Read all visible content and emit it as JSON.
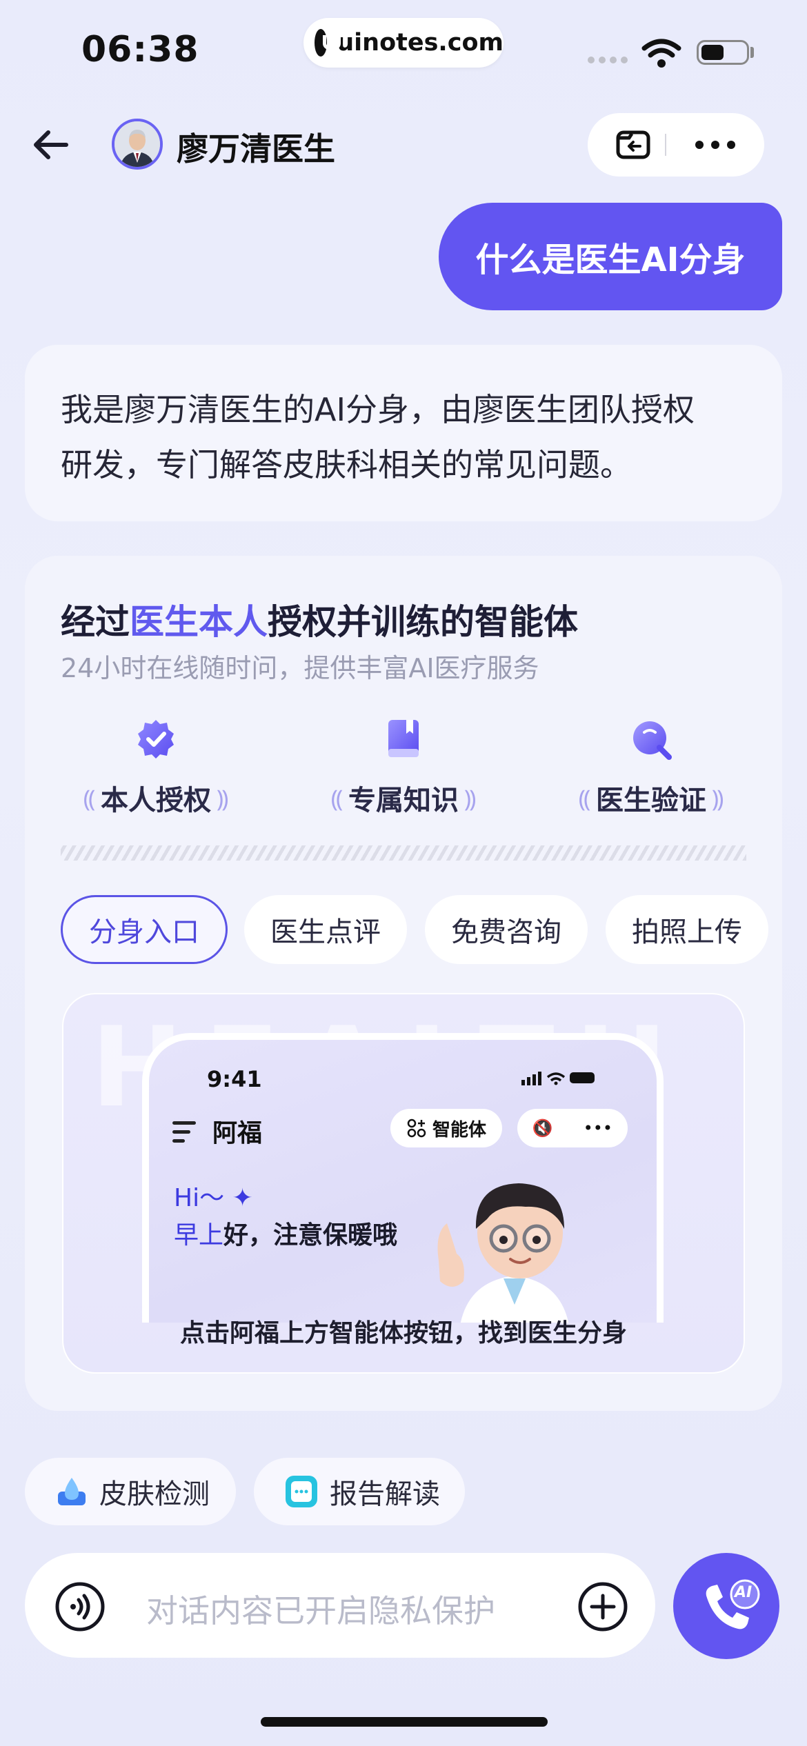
{
  "status_bar": {
    "time": "06:38",
    "url": "uinotes.com"
  },
  "header": {
    "doctor_name": "廖万清医生"
  },
  "chat": {
    "user_message": "什么是医生AI分身",
    "ai_message_line1": "我是廖万清医生的AI分身，由廖医生团队授权",
    "ai_message_line2": "研发，专门解答皮肤科相关的常见问题。"
  },
  "card": {
    "title_pre": "经过",
    "title_highlight": "医生本人",
    "title_post": "授权并训练的智能体",
    "subtitle": "24小时在线随时问，提供丰富AI医疗服务",
    "features": [
      {
        "label": "本人授权",
        "icon": "shield-check-icon"
      },
      {
        "label": "专属知识",
        "icon": "book-icon"
      },
      {
        "label": "医生验证",
        "icon": "magnifier-icon"
      }
    ],
    "tabs": [
      "分身入口",
      "医生点评",
      "免费咨询",
      "拍照上传"
    ],
    "active_tab": "分身入口",
    "promo": {
      "bg_text": "HEALTH",
      "phone_time": "9:41",
      "assistant_name": "阿福",
      "agent_button": "智能体",
      "hi": "Hi～",
      "greet_highlight": "早上",
      "greet_rest": "好，注意保暖哦",
      "caption": "点击阿福上方智能体按钮，找到医生分身"
    }
  },
  "quick_actions": [
    {
      "label": "皮肤检测",
      "icon": "skin-drop-icon"
    },
    {
      "label": "报告解读",
      "icon": "report-chat-icon"
    }
  ],
  "input": {
    "placeholder": "对话内容已开启隐私保护"
  },
  "call_button": {
    "badge": "AI"
  },
  "colors": {
    "accent": "#6255f1",
    "highlight": "#6059ee",
    "background": "#eceefb"
  }
}
